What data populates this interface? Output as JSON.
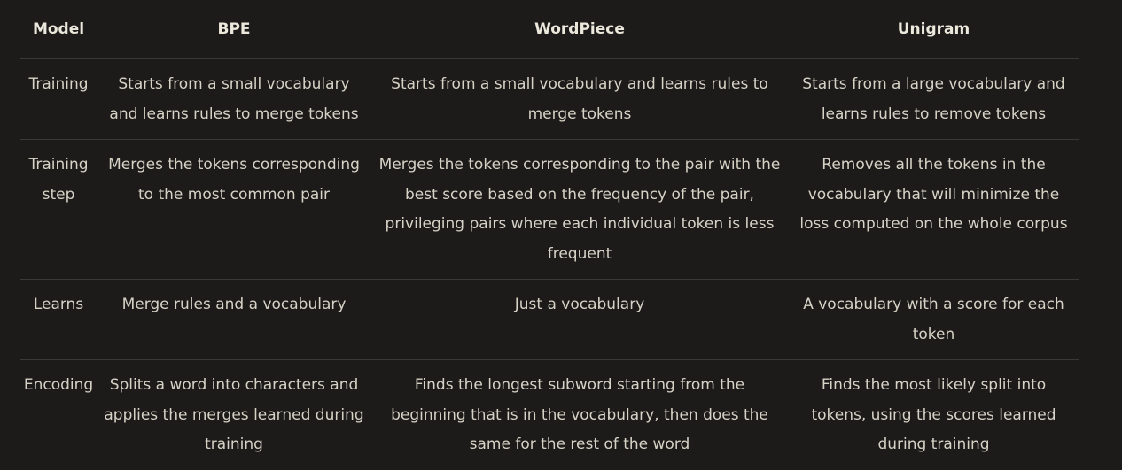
{
  "table": {
    "headers": [
      "Model",
      "BPE",
      "WordPiece",
      "Unigram"
    ],
    "rows": [
      {
        "label": "Training",
        "bpe": "Starts from a small vocabulary and learns rules to merge tokens",
        "wordpiece": "Starts from a small vocabulary and learns rules to merge tokens",
        "unigram": "Starts from a large vocabulary and learns rules to remove tokens"
      },
      {
        "label": "Training step",
        "bpe": "Merges the tokens corresponding to the most common pair",
        "wordpiece": "Merges the tokens corresponding to the pair with the best score based on the frequency of the pair, privileging pairs where each individual token is less frequent",
        "unigram": "Removes all the tokens in the vocabulary that will minimize the loss computed on the whole corpus"
      },
      {
        "label": "Learns",
        "bpe": "Merge rules and a vocabulary",
        "wordpiece": "Just a vocabulary",
        "unigram": "A vocabulary with a score for each token"
      },
      {
        "label": "Encoding",
        "bpe": "Splits a word into characters and applies the merges learned during training",
        "wordpiece": "Finds the longest subword starting from the beginning that is in the vocabulary, then does the same for the rest of the word",
        "unigram": "Finds the most likely split into tokens, using the scores learned during training"
      }
    ]
  }
}
